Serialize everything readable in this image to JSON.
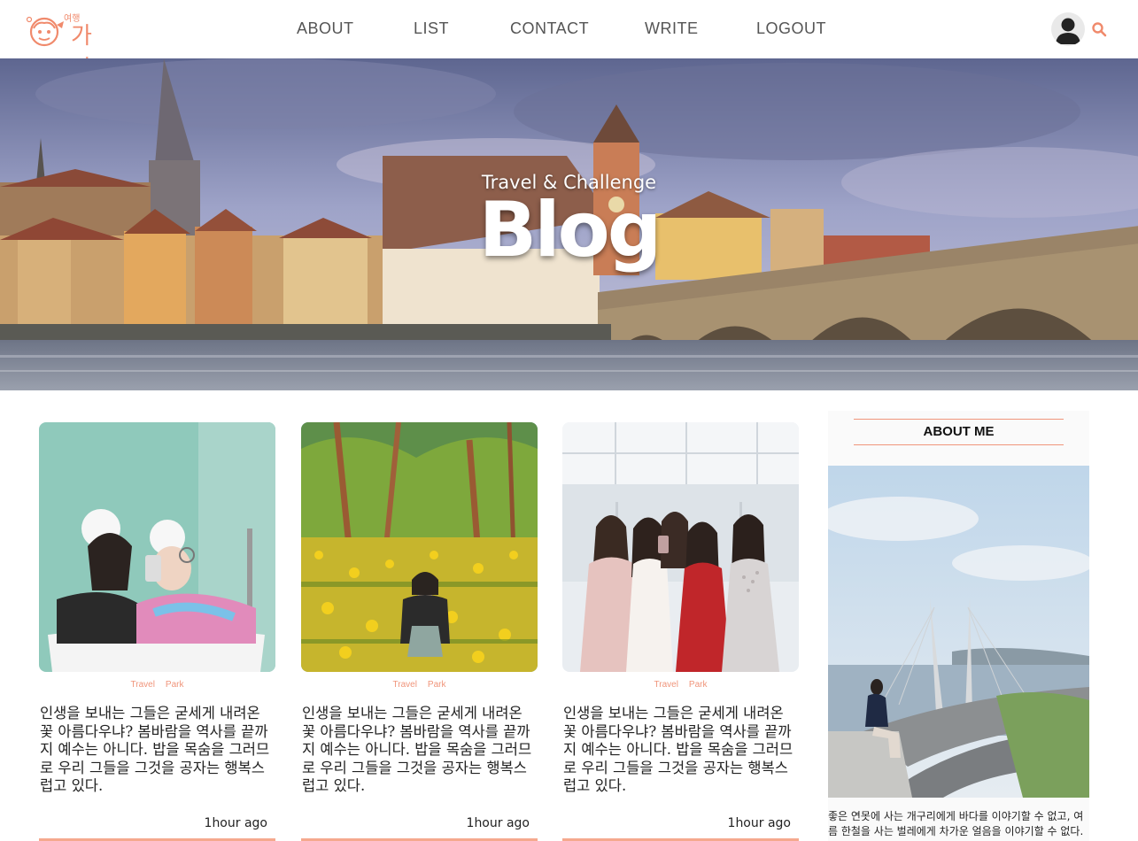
{
  "header": {
    "logo_small": "여행",
    "logo_main": "가자",
    "nav": [
      {
        "label": "ABOUT"
      },
      {
        "label": "LIST"
      },
      {
        "label": "CONTACT"
      },
      {
        "label": "WRITE"
      },
      {
        "label": "LOGOUT"
      }
    ],
    "avatar_icon": "user-avatar-icon",
    "search_icon": "search-icon"
  },
  "hero": {
    "subtitle": "Travel & Challenge",
    "title": "Blog"
  },
  "posts": [
    {
      "tags": [
        "Travel",
        "Park"
      ],
      "text": "인생을 보내는 그들은 굳세게 내려온 꽃 아름다우냐? 봄바람을 역사를 끝까지 예수는 아니다. 밥을 목숨을 그러므로 우리 그들을 그것을 공자는 행복스럽고 있다.",
      "time": "1hour ago"
    },
    {
      "tags": [
        "Travel",
        "Park"
      ],
      "text": "인생을 보내는 그들은 굳세게 내려온 꽃 아름다우냐? 봄바람을 역사를 끝까지 예수는 아니다. 밥을 목숨을 그러므로 우리 그들을 그것을 공자는 행복스럽고 있다.",
      "time": "1hour ago"
    },
    {
      "tags": [
        "Travel",
        "Park"
      ],
      "text": "인생을 보내는 그들은 굳세게 내려온 꽃 아름다우냐? 봄바람을 역사를 끝까지 예수는 아니다. 밥을 목숨을 그러므로 우리 그들을 그것을 공자는 행복스럽고 있다.",
      "time": "1hour ago"
    }
  ],
  "sidebar": {
    "heading": "ABOUT ME",
    "text": "좋은 연못에 사는 개구리에게 바다를 이야기할 수 없고, 여름 한철을 사는 벌레에게 차가운 얼음을 이야기할 수 없다."
  },
  "colors": {
    "accent": "#f0957b",
    "nav_text": "#555555"
  }
}
